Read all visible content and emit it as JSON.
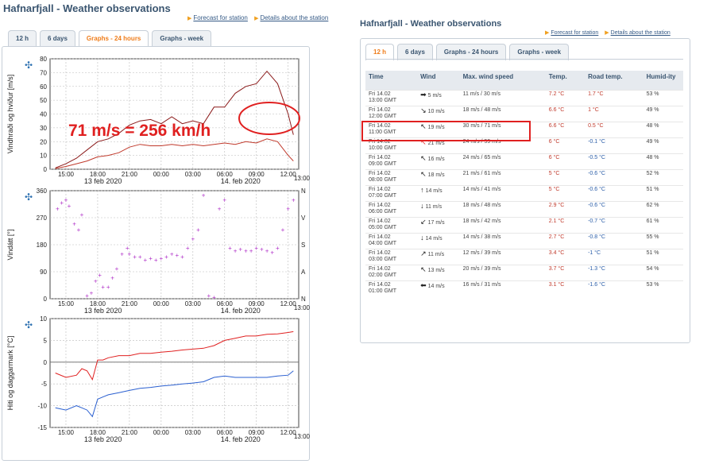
{
  "left": {
    "title": "Hafnarfjall - Weather observations",
    "links": [
      "Forecast for station",
      "Details about the station"
    ],
    "tabs": [
      {
        "label": "12 h",
        "active": false
      },
      {
        "label": "6 days",
        "active": false
      },
      {
        "label": "Graphs - 24 hours",
        "active": true
      },
      {
        "label": "Graphs - week",
        "active": false
      }
    ],
    "x_ticks": [
      "15:00",
      "18:00",
      "21:00",
      "00:00",
      "03:00",
      "06:00",
      "09:00",
      "12:00"
    ],
    "x_date_left": "13 feb 2020",
    "x_date_right": "14. feb 2020",
    "x_end": "13:00",
    "annotation": "71 m/s = 256 km/h",
    "accent": "#e02020"
  },
  "chart_data": [
    {
      "type": "line",
      "ylabel": "Vindhraði og hviður [m/s]",
      "yticks": [
        "80",
        "70",
        "60",
        "50",
        "40",
        "30",
        "20",
        "10",
        "0"
      ],
      "ylim": [
        0,
        80
      ],
      "series": [
        {
          "color": "#8b1a1a",
          "x": [
            14,
            15,
            16,
            17,
            18,
            19,
            20,
            21,
            22,
            23,
            24,
            25,
            26,
            27,
            28,
            29,
            30,
            31,
            32,
            33,
            34,
            35,
            36,
            36.5
          ],
          "values": [
            1,
            4,
            8,
            14,
            20,
            22,
            26,
            32,
            35,
            36,
            33,
            38,
            33,
            35,
            33,
            45,
            45,
            55,
            60,
            62,
            71,
            62,
            40,
            25
          ]
        },
        {
          "color": "#c0392b",
          "x": [
            14,
            15,
            16,
            17,
            18,
            19,
            20,
            21,
            22,
            23,
            24,
            25,
            26,
            27,
            28,
            29,
            30,
            31,
            32,
            33,
            34,
            35,
            36,
            36.5
          ],
          "values": [
            0.5,
            2,
            4,
            6,
            9,
            10,
            12,
            16,
            18,
            17,
            17,
            18,
            17,
            18,
            17,
            18,
            19,
            18,
            20,
            19,
            22,
            20,
            10,
            6
          ]
        }
      ]
    },
    {
      "type": "scatter",
      "ylabel": "Vindátt [°]",
      "yticks": [
        "0",
        "90",
        "180",
        "270",
        "360"
      ],
      "ylim": [
        360,
        0
      ],
      "right_labels": [
        "N",
        "A",
        "S",
        "V",
        "N"
      ],
      "series": [
        {
          "color": "#b030c8",
          "x": [
            14.2,
            14.6,
            15,
            15.3,
            15.8,
            16.2,
            16.5,
            17,
            17.4,
            17.8,
            18.2,
            18.5,
            19,
            19.4,
            19.8,
            20.3,
            20.8,
            21,
            21.5,
            22,
            22.5,
            23,
            23.5,
            24,
            24.5,
            25,
            25.5,
            26,
            26.5,
            27,
            27.5,
            28,
            28.5,
            29,
            29.5,
            30,
            30.5,
            31,
            31.5,
            32,
            32.5,
            33,
            33.5,
            34,
            34.5,
            35,
            35.5,
            36,
            36.5
          ],
          "values": [
            300,
            320,
            330,
            310,
            250,
            230,
            280,
            10,
            20,
            60,
            80,
            40,
            40,
            70,
            100,
            150,
            170,
            150,
            140,
            140,
            130,
            135,
            130,
            135,
            140,
            150,
            145,
            140,
            170,
            200,
            230,
            345,
            10,
            5,
            300,
            330,
            170,
            160,
            165,
            160,
            160,
            170,
            165,
            160,
            155,
            170,
            230,
            300,
            330
          ]
        }
      ]
    },
    {
      "type": "line",
      "ylabel": "Hiti og daggarmark [°C]",
      "yticks": [
        "10",
        "5",
        "0",
        "-5",
        "-10",
        "-15"
      ],
      "ylim": [
        -15,
        10
      ],
      "series": [
        {
          "color": "#e02020",
          "x": [
            14,
            15,
            16,
            16.5,
            17,
            17.5,
            18,
            18.5,
            19,
            20,
            21,
            22,
            23,
            24,
            25,
            26,
            27,
            28,
            29,
            30,
            31,
            32,
            33,
            34,
            35,
            36,
            36.5
          ],
          "values": [
            -2.5,
            -3.5,
            -3,
            -1.5,
            -2,
            -4,
            0.5,
            0.5,
            1,
            1.5,
            1.5,
            2,
            2,
            2.3,
            2.5,
            2.8,
            3,
            3.2,
            3.8,
            5,
            5.5,
            6,
            6,
            6.4,
            6.5,
            6.8,
            7
          ]
        },
        {
          "color": "#2a5fd0",
          "x": [
            14,
            15,
            16,
            16.5,
            17,
            17.5,
            18,
            18.5,
            19,
            20,
            21,
            22,
            23,
            24,
            25,
            26,
            27,
            28,
            29,
            30,
            31,
            32,
            33,
            34,
            35,
            36,
            36.5
          ],
          "values": [
            -10.5,
            -11,
            -10,
            -10.5,
            -11,
            -12.5,
            -8.5,
            -8,
            -7.5,
            -7,
            -6.5,
            -6,
            -5.8,
            -5.5,
            -5.3,
            -5,
            -4.8,
            -4.5,
            -3.5,
            -3.2,
            -3.5,
            -3.5,
            -3.5,
            -3.5,
            -3.2,
            -3,
            -2
          ]
        }
      ]
    }
  ],
  "right": {
    "title": "Hafnarfjall - Weather observations",
    "links": [
      "Forecast for station",
      "Details about the station"
    ],
    "tabs": [
      {
        "label": "12 h",
        "active": true
      },
      {
        "label": "6 days",
        "active": false
      },
      {
        "label": "Graphs - 24 hours",
        "active": false
      },
      {
        "label": "Graphs - week",
        "active": false
      }
    ],
    "table": {
      "headers": [
        "Time",
        "Wind",
        "Max. wind speed",
        "Temp.",
        "Road temp.",
        "Humid-ity"
      ],
      "rows": [
        {
          "time1": "Fri 14.02",
          "time2": "13:00 GMT",
          "arrow": "➡",
          "arrow_color": "#222",
          "wind": "5 m/s",
          "max": "11 m/s  /  30 m/s",
          "temp": "7.2 °C",
          "road": "1.7 °C",
          "road_color": "red",
          "hum": "53 %"
        },
        {
          "time1": "Fri 14.02",
          "time2": "12:00 GMT",
          "arrow": "↘",
          "arrow_color": "#222",
          "wind": "10 m/s",
          "max": "18 m/s  /  48 m/s",
          "temp": "6.6 °C",
          "road": "1 °C",
          "road_color": "red",
          "hum": "49 %"
        },
        {
          "time1": "Fri 14.02",
          "time2": "11:00 GMT",
          "arrow": "↖",
          "arrow_color": "#222",
          "wind": "19 m/s",
          "max": "30 m/s  /  71 m/s",
          "temp": "6.6 °C",
          "road": "0.5 °C",
          "road_color": "red",
          "hum": "48 %",
          "highlight": true
        },
        {
          "time1": "Fri 14.02",
          "time2": "10:00 GMT",
          "arrow": "↖",
          "arrow_color": "#e02020",
          "wind": "21 m/s",
          "max": "24 m/s  /  59 m/s",
          "temp": "6 °C",
          "road": "-0.1 °C",
          "road_color": "blue",
          "hum": "49 %"
        },
        {
          "time1": "Fri 14.02",
          "time2": "09:00 GMT",
          "arrow": "↖",
          "arrow_color": "#222",
          "wind": "16 m/s",
          "max": "24 m/s  /  65 m/s",
          "temp": "6 °C",
          "road": "-0.5 °C",
          "road_color": "blue",
          "hum": "48 %"
        },
        {
          "time1": "Fri 14.02",
          "time2": "08:00 GMT",
          "arrow": "↖",
          "arrow_color": "#222",
          "wind": "18 m/s",
          "max": "21 m/s  /  61 m/s",
          "temp": "5 °C",
          "road": "-0.6 °C",
          "road_color": "blue",
          "hum": "52 %"
        },
        {
          "time1": "Fri 14.02",
          "time2": "07:00 GMT",
          "arrow": "↑",
          "arrow_color": "#222",
          "wind": "14 m/s",
          "max": "14 m/s  /  41 m/s",
          "temp": "5 °C",
          "road": "-0.6 °C",
          "road_color": "blue",
          "hum": "51 %"
        },
        {
          "time1": "Fri 14.02",
          "time2": "06:00 GMT",
          "arrow": "↓",
          "arrow_color": "#222",
          "wind": "11 m/s",
          "max": "18 m/s  /  48 m/s",
          "temp": "2.9 °C",
          "road": "-0.6 °C",
          "road_color": "blue",
          "hum": "62 %"
        },
        {
          "time1": "Fri 14.02",
          "time2": "05:00 GMT",
          "arrow": "↙",
          "arrow_color": "#222",
          "wind": "17 m/s",
          "max": "18 m/s  /  42 m/s",
          "temp": "2.1 °C",
          "road": "-0.7 °C",
          "road_color": "blue",
          "hum": "61 %"
        },
        {
          "time1": "Fri 14.02",
          "time2": "04:00 GMT",
          "arrow": "↓",
          "arrow_color": "#222",
          "wind": "14 m/s",
          "max": "14 m/s  /  38 m/s",
          "temp": "2.7 °C",
          "road": "-0.8 °C",
          "road_color": "blue",
          "hum": "55 %"
        },
        {
          "time1": "Fri 14.02",
          "time2": "03:00 GMT",
          "arrow": "↗",
          "arrow_color": "#222",
          "wind": "11 m/s",
          "max": "12 m/s  /  39 m/s",
          "temp": "3.4 °C",
          "road": "-1 °C",
          "road_color": "blue",
          "hum": "51 %"
        },
        {
          "time1": "Fri 14.02",
          "time2": "02:00 GMT",
          "arrow": "↖",
          "arrow_color": "#222",
          "wind": "13 m/s",
          "max": "20 m/s  /  39 m/s",
          "temp": "3.7 °C",
          "road": "-1.3 °C",
          "road_color": "blue",
          "hum": "54 %"
        },
        {
          "time1": "Fri 14.02",
          "time2": "01:00 GMT",
          "arrow": "⬅",
          "arrow_color": "#222",
          "wind": "14 m/s",
          "max": "16 m/s  /  31 m/s",
          "temp": "3.1 °C",
          "road": "-1.6 °C",
          "road_color": "blue",
          "hum": "53 %"
        }
      ]
    }
  }
}
